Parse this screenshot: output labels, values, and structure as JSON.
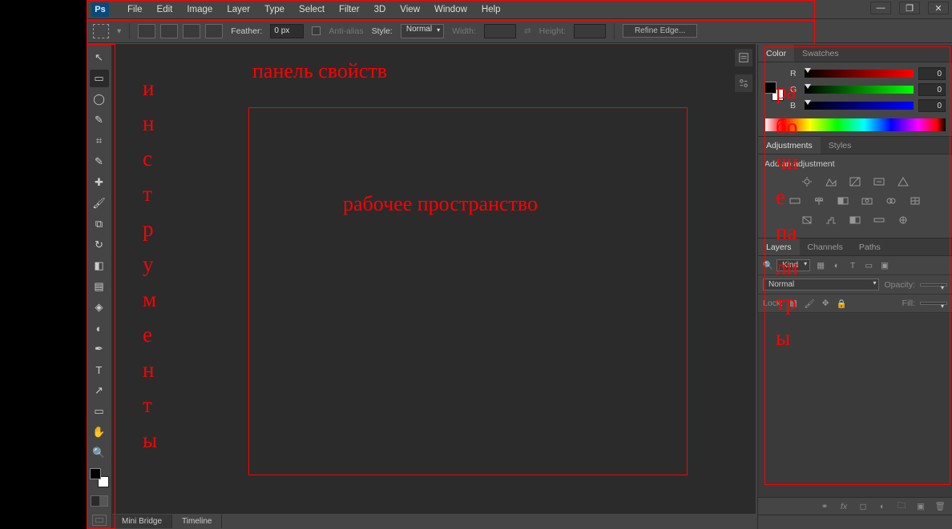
{
  "menubar": {
    "logo": "Ps",
    "items": [
      "File",
      "Edit",
      "Image",
      "Layer",
      "Type",
      "Select",
      "Filter",
      "3D",
      "View",
      "Window",
      "Help"
    ]
  },
  "window_controls": {
    "min": "—",
    "max": "❐",
    "close": "✕"
  },
  "optionsbar": {
    "feather_label": "Feather:",
    "feather_value": "0 px",
    "antialias_label": "Anti-alias",
    "style_label": "Style:",
    "style_value": "Normal",
    "width_label": "Width:",
    "height_label": "Height:",
    "refine_label": "Refine Edge..."
  },
  "tools": [
    {
      "n": "move-tool",
      "t": "↖"
    },
    {
      "n": "marquee-tool",
      "t": "▭",
      "active": true
    },
    {
      "n": "lasso-tool",
      "t": "◯"
    },
    {
      "n": "quick-select-tool",
      "t": "✎"
    },
    {
      "n": "crop-tool",
      "t": "⌗"
    },
    {
      "n": "eyedropper-tool",
      "t": "✎"
    },
    {
      "n": "healing-tool",
      "t": "✚"
    },
    {
      "n": "brush-tool",
      "t": "🖌"
    },
    {
      "n": "clone-tool",
      "t": "⧉"
    },
    {
      "n": "history-brush-tool",
      "t": "↻"
    },
    {
      "n": "eraser-tool",
      "t": "◧"
    },
    {
      "n": "gradient-tool",
      "t": "▤"
    },
    {
      "n": "blur-tool",
      "t": "◈"
    },
    {
      "n": "dodge-tool",
      "t": "◐"
    },
    {
      "n": "pen-tool",
      "t": "✒"
    },
    {
      "n": "type-tool",
      "t": "T"
    },
    {
      "n": "path-select-tool",
      "t": "↗"
    },
    {
      "n": "shape-tool",
      "t": "▭"
    },
    {
      "n": "hand-tool",
      "t": "✋"
    },
    {
      "n": "zoom-tool",
      "t": "🔍"
    }
  ],
  "bottom_tabs": {
    "mini_bridge": "Mini Bridge",
    "timeline": "Timeline"
  },
  "panels": {
    "color": {
      "tab_color": "Color",
      "tab_swatches": "Swatches",
      "channels": [
        {
          "l": "R",
          "v": "0",
          "grad": "linear-gradient(90deg,#000,#f00)"
        },
        {
          "l": "G",
          "v": "0",
          "grad": "linear-gradient(90deg,#000,#0f0)"
        },
        {
          "l": "B",
          "v": "0",
          "grad": "linear-gradient(90deg,#000,#00f)"
        }
      ]
    },
    "adjustments": {
      "tab_adj": "Adjustments",
      "tab_styles": "Styles",
      "title": "Add an adjustment"
    },
    "layers": {
      "tab_layers": "Layers",
      "tab_channels": "Channels",
      "tab_paths": "Paths",
      "kind_label": "Kind",
      "kind_value": " ",
      "blend_value": "Normal",
      "opacity_label": "Opacity:",
      "lock_label": "Lock:",
      "fill_label": "Fill:"
    }
  },
  "annotations": {
    "options_label": "панель свойств",
    "workspace_label": "рабочее пространство",
    "tools_label": "инструменты",
    "palettes_label": "рабочие палитры"
  }
}
